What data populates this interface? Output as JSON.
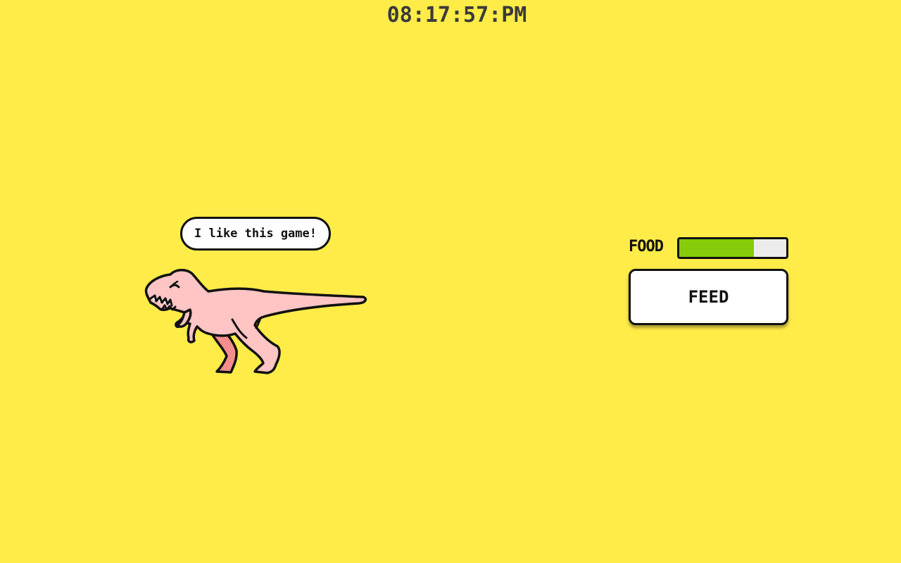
{
  "clock": {
    "time": "08:17:57:PM"
  },
  "pet": {
    "speech": "I like this game!",
    "icon": "t-rex-pet-icon",
    "body_color": "#ffc4c4",
    "leg_color": "#f48e8e"
  },
  "food": {
    "label": "FOOD",
    "level_fraction": 0.7,
    "fill_color": "#86cc0a"
  },
  "actions": {
    "feed_label": "FEED"
  },
  "colors": {
    "background": "#ffec48"
  }
}
